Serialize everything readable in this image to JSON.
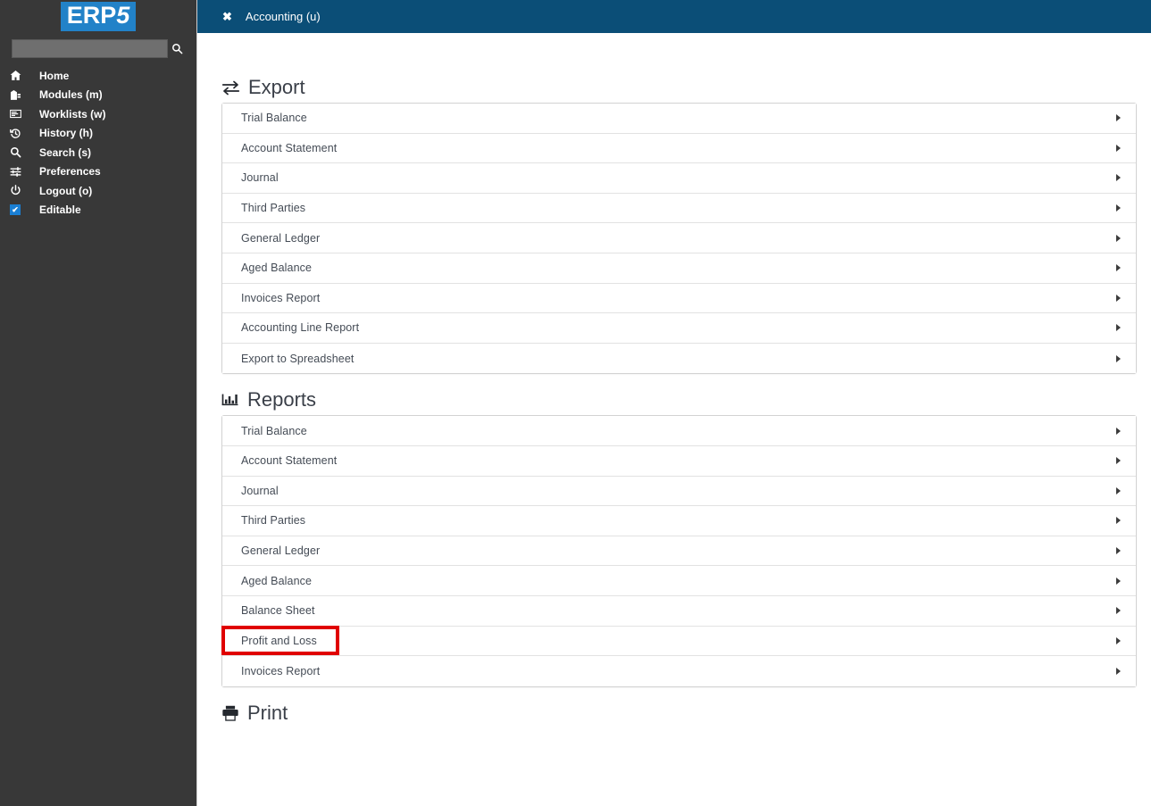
{
  "sidebar": {
    "logo": {
      "main": "ERP",
      "five": "5"
    },
    "search": {
      "value": "",
      "placeholder": "",
      "icon": "search-icon"
    },
    "items": [
      {
        "label": "Home",
        "icon": "home-icon"
      },
      {
        "label": "Modules (m)",
        "icon": "modules-icon"
      },
      {
        "label": "Worklists (w)",
        "icon": "worklists-icon"
      },
      {
        "label": "History (h)",
        "icon": "history-icon"
      },
      {
        "label": "Search (s)",
        "icon": "search-icon"
      },
      {
        "label": "Preferences",
        "icon": "sliders-icon"
      },
      {
        "label": "Logout (o)",
        "icon": "power-icon"
      },
      {
        "label": "Editable",
        "icon": "checkbox-checked-icon",
        "checked": true,
        "check_glyph": "✔"
      }
    ]
  },
  "tabbar": {
    "tabs": [
      {
        "label": "Accounting (u)",
        "close_glyph": "✖",
        "active": true
      }
    ]
  },
  "main": {
    "sections": [
      {
        "id": "export",
        "title": "Export",
        "icon": "exchange-icon",
        "items": [
          {
            "label": "Trial Balance"
          },
          {
            "label": "Account Statement"
          },
          {
            "label": "Journal"
          },
          {
            "label": "Third Parties"
          },
          {
            "label": "General Ledger"
          },
          {
            "label": "Aged Balance"
          },
          {
            "label": "Invoices Report"
          },
          {
            "label": "Accounting Line Report"
          },
          {
            "label": "Export to Spreadsheet"
          }
        ]
      },
      {
        "id": "reports",
        "title": "Reports",
        "icon": "bar-chart-icon",
        "items": [
          {
            "label": "Trial Balance"
          },
          {
            "label": "Account Statement"
          },
          {
            "label": "Journal"
          },
          {
            "label": "Third Parties"
          },
          {
            "label": "General Ledger"
          },
          {
            "label": "Aged Balance"
          },
          {
            "label": "Balance Sheet"
          },
          {
            "label": "Profit and Loss",
            "highlighted": true
          },
          {
            "label": "Invoices Report"
          }
        ]
      },
      {
        "id": "print",
        "title": "Print",
        "icon": "printer-icon",
        "items": []
      }
    ]
  },
  "colors": {
    "sidebar_bg": "#383838",
    "tabbar_bg": "#0b4e77",
    "logo_bg": "#2282c8",
    "accent_blue": "#1a7fd4",
    "highlight_red": "#e00000",
    "row_text": "#444b55",
    "title_text": "#3a3f48"
  }
}
